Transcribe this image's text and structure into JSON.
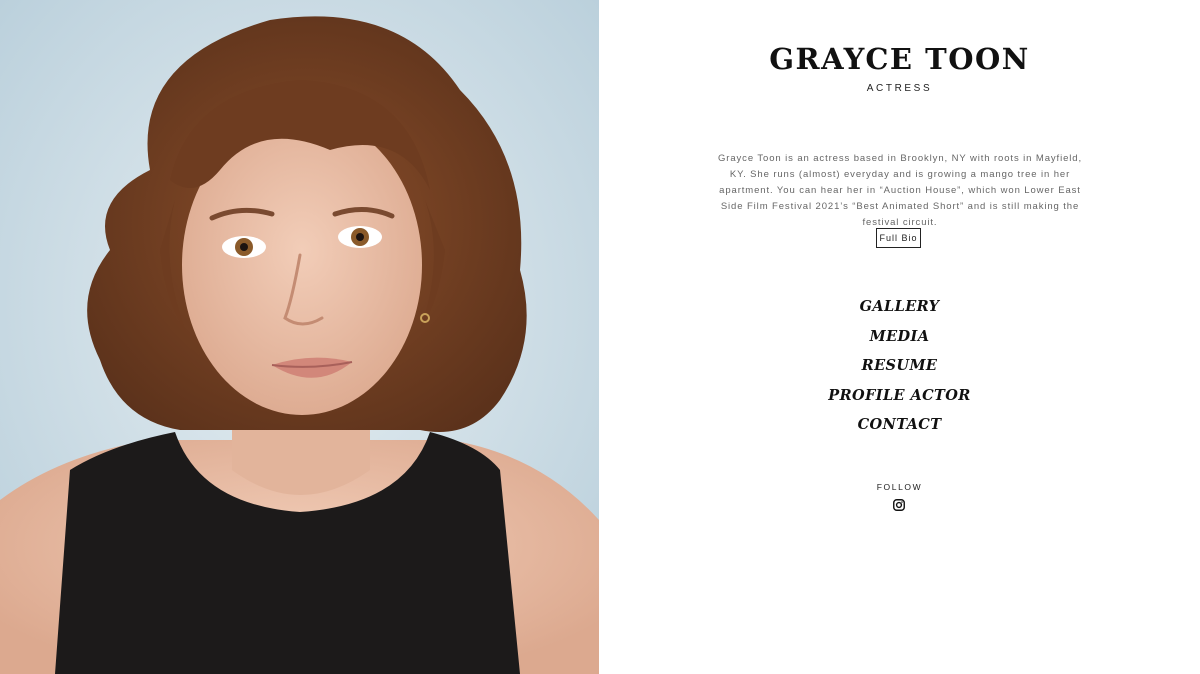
{
  "header": {
    "name": "GRAYCE TOON",
    "role": "ACTRESS"
  },
  "bio": {
    "text": "Grayce Toon is an actress based in Brooklyn, NY with roots in Mayfield, KY. She runs (almost) everyday and is growing a mango tree in her apartment. You can hear her in “Auction House”, which won Lower East Side Film Festival 2021’s “Best Animated Short” and is still making the festival circuit.",
    "button_label": "Full Bio"
  },
  "nav": {
    "items": [
      {
        "label": "GALLERY"
      },
      {
        "label": "MEDIA"
      },
      {
        "label": "RESUME"
      },
      {
        "label": "PROFILE ACTOR"
      },
      {
        "label": "CONTACT"
      }
    ]
  },
  "social": {
    "follow_label": "FOLLOW",
    "icon": "instagram-icon"
  },
  "colors": {
    "text": "#111111",
    "bio_text": "#666666",
    "background": "#ffffff",
    "portrait_backdrop": "#cddde6"
  }
}
